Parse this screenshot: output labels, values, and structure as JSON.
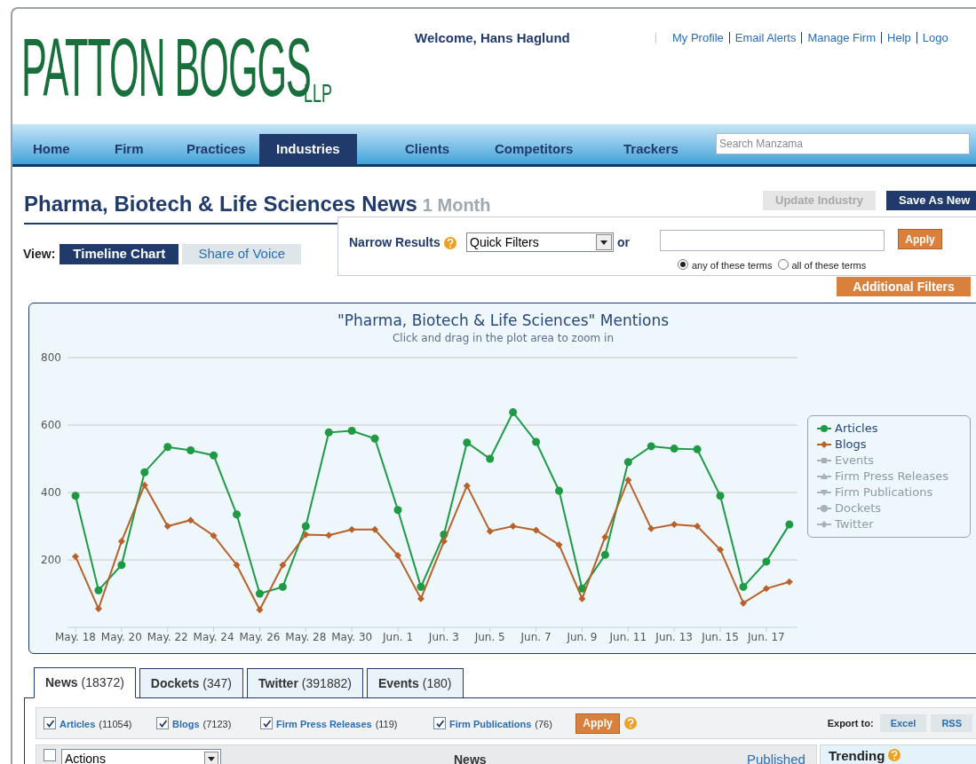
{
  "logo": {
    "name": "PATTON BOGGS",
    "suffix": "LLP"
  },
  "welcome": "Welcome, Hans Haglund",
  "top_links": [
    "My Profile",
    "Email Alerts",
    "Manage Firm",
    "Help",
    "Logo"
  ],
  "nav": [
    {
      "label": "Home",
      "selected": false
    },
    {
      "label": "Firm",
      "selected": false
    },
    {
      "label": "Practices",
      "selected": false
    },
    {
      "label": "Industries",
      "selected": true
    },
    {
      "label": "Clients",
      "selected": false
    },
    {
      "label": "Competitors",
      "selected": false
    },
    {
      "label": "Trackers",
      "selected": false
    }
  ],
  "search": {
    "placeholder": "Search Manzama"
  },
  "page_title": {
    "title": "Pharma, Biotech & Life Sciences News",
    "period": "1 Month"
  },
  "actions": [
    {
      "label": "Update Industry",
      "disabled": true
    },
    {
      "label": "Save As New",
      "disabled": false
    }
  ],
  "view": {
    "label": "View:",
    "options": [
      {
        "label": "Timeline Chart",
        "selected": true
      },
      {
        "label": "Share of Voice",
        "selected": false
      }
    ]
  },
  "narrow": {
    "label": "Narrow Results",
    "select": "Quick Filters",
    "or": "or",
    "apply": "Apply",
    "radios": [
      {
        "label": "any of these terms",
        "selected": true
      },
      {
        "label": "all of these terms",
        "selected": false
      }
    ],
    "additional": "Additional Filters"
  },
  "chart": {
    "subtitle": "Click and drag in the plot area to zoom in",
    "legend": [
      {
        "label": "Events",
        "hidden": true,
        "kind": "square"
      },
      {
        "label": "Firm Press Releases",
        "hidden": true,
        "kind": "triangle"
      },
      {
        "label": "Firm Publications",
        "hidden": true,
        "kind": "triangle-down"
      },
      {
        "label": "Dockets",
        "hidden": true,
        "kind": "circle"
      },
      {
        "label": "Twitter",
        "hidden": true,
        "kind": "diamond"
      }
    ],
    "chart_data": {
      "type": "line",
      "title": "\"Pharma, Biotech & Life Sciences\" Mentions",
      "categories": [
        "May. 18",
        null,
        "May. 20",
        null,
        "May. 22",
        null,
        "May. 24",
        null,
        "May. 26",
        null,
        "May. 28",
        null,
        "May. 30",
        null,
        "Jun. 1",
        null,
        "Jun. 3",
        null,
        "Jun. 5",
        null,
        "Jun. 7",
        null,
        "Jun. 9",
        null,
        "Jun. 11",
        null,
        "Jun. 13",
        null,
        "Jun. 15",
        null,
        "Jun. 17",
        null
      ],
      "series": [
        {
          "name": "Articles",
          "color": "#1e9a45",
          "marker": "circle",
          "values": [
            390,
            110,
            185,
            460,
            535,
            525,
            510,
            335,
            100,
            120,
            300,
            578,
            583,
            560,
            348,
            120,
            275,
            548,
            500,
            638,
            550,
            405,
            115,
            215,
            490,
            537,
            530,
            528,
            390,
            120,
            195,
            305
          ]
        },
        {
          "name": "Blogs",
          "color": "#b8612a",
          "marker": "diamond",
          "values": [
            210,
            55,
            255,
            422,
            300,
            318,
            272,
            185,
            52,
            185,
            275,
            273,
            290,
            290,
            213,
            85,
            255,
            420,
            285,
            300,
            288,
            245,
            85,
            268,
            437,
            293,
            305,
            300,
            230,
            72,
            115,
            135
          ]
        }
      ],
      "ylim": [
        0,
        800
      ],
      "yticks": [
        200,
        400,
        600,
        800
      ],
      "grid": true,
      "legend": "right"
    }
  },
  "tabs": [
    {
      "label": "News",
      "count": "(18372)",
      "selected": true
    },
    {
      "label": "Dockets",
      "count": "(347)",
      "selected": false
    },
    {
      "label": "Twitter",
      "count": "(391882)",
      "selected": false
    },
    {
      "label": "Events",
      "count": "(180)",
      "selected": false
    }
  ],
  "sources": [
    {
      "label": "Articles",
      "count": "(11054)",
      "checked": true
    },
    {
      "label": "Blogs",
      "count": "(7123)",
      "checked": true
    },
    {
      "label": "Firm Press Releases",
      "count": "(119)",
      "checked": true
    },
    {
      "label": "Firm Publications",
      "count": "(76)",
      "checked": true
    }
  ],
  "sources_apply": "Apply",
  "export": {
    "label": "Export to:",
    "options": [
      "Excel",
      "RSS"
    ]
  },
  "list_header": {
    "select_all_checked": false,
    "actions": "Actions",
    "news": "News",
    "published": "Published",
    "trending": "Trending"
  }
}
